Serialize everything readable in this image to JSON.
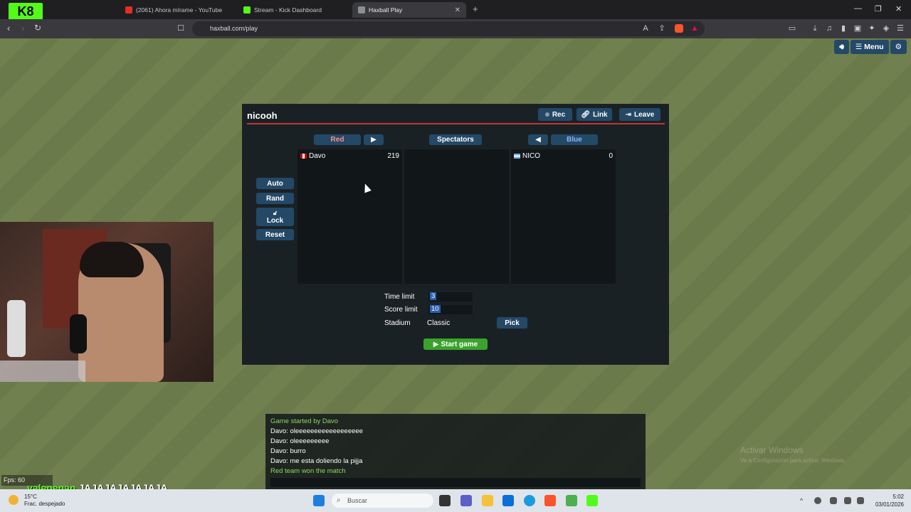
{
  "browser": {
    "tabs": [
      {
        "label": "(2061) Ahora mírame - YouTube"
      },
      {
        "label": "Stream - Kick Dashboard"
      },
      {
        "label": "Haxball Play"
      }
    ],
    "url": "haxball.com/play"
  },
  "game": {
    "top_buttons": {
      "menu": "Menu"
    },
    "room": {
      "title": "nicooh",
      "rec": "Rec",
      "link": "Link",
      "leave": "Leave",
      "red_label": "Red",
      "spectators_label": "Spectators",
      "blue_label": "Blue",
      "side_buttons": {
        "auto": "Auto",
        "rand": "Rand",
        "lock": "Lock",
        "reset": "Reset"
      },
      "red_players": [
        {
          "name": "Davo",
          "score": "219"
        }
      ],
      "blue_players": [
        {
          "name": "NICO",
          "score": "0"
        }
      ],
      "settings": {
        "time_limit_label": "Time limit",
        "time_limit_value": "3",
        "score_limit_label": "Score limit",
        "score_limit_value": "10",
        "stadium_label": "Stadium",
        "stadium_value": "Classic",
        "pick": "Pick"
      },
      "start_game": "Start game"
    },
    "chat": [
      {
        "text": "Game started by Davo",
        "system": true
      },
      {
        "text": "Davo: oleeeeeeeeeeeeeeeeee",
        "system": false
      },
      {
        "text": "Davo: oleeeeeeeee",
        "system": false
      },
      {
        "text": "Davo: burro",
        "system": false
      },
      {
        "text": "Davo: me esta doliendo la pijja",
        "system": false
      },
      {
        "text": "Red team won the match",
        "system": true
      }
    ],
    "fps": "Fps: 60"
  },
  "stream_overlay": {
    "username": "valenenan",
    "message": "JAJAJAJAJAJAJA"
  },
  "watermark": {
    "title": "Activar Windows",
    "subtitle": "Ve a Configuración para activar Windows."
  },
  "taskbar": {
    "weather_temp": "15°C",
    "weather_desc": "Frac. despejado",
    "search_placeholder": "Buscar",
    "time": "5:02",
    "date": "03/01/2026"
  }
}
